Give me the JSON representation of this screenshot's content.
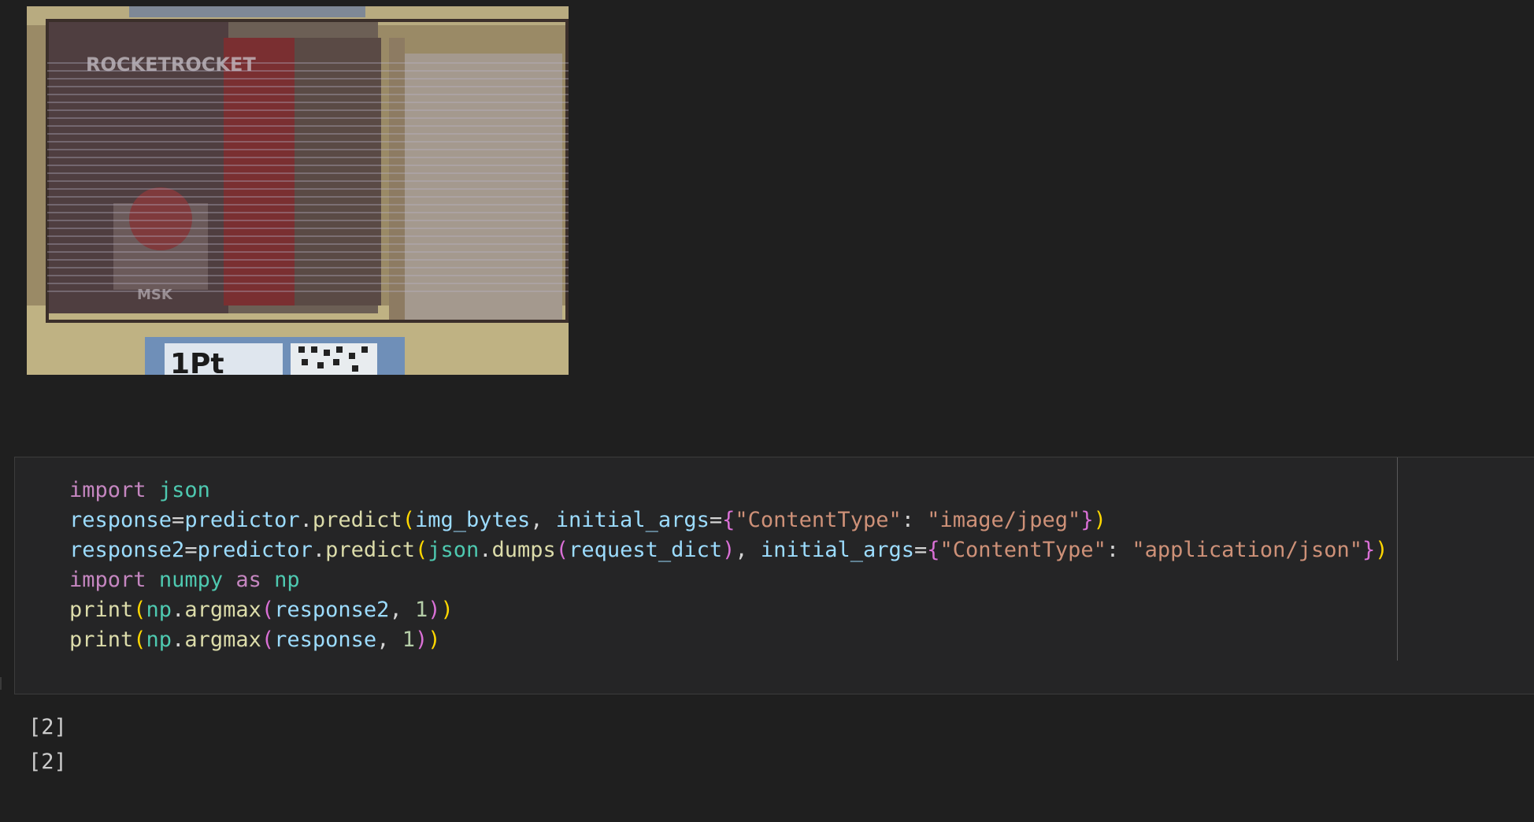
{
  "output_image": {
    "alt": "",
    "carton_brand_text": "ROCKETROCKET",
    "carton_bottom_text": "MSK",
    "price_tag_text": "1Pt"
  },
  "code_cell": {
    "lines": [
      [
        {
          "t": "import",
          "c": "kw"
        },
        {
          "t": " ",
          "c": "op"
        },
        {
          "t": "json",
          "c": "mod"
        }
      ],
      [
        {
          "t": "response",
          "c": "var"
        },
        {
          "t": "=",
          "c": "op"
        },
        {
          "t": "predictor",
          "c": "var"
        },
        {
          "t": ".",
          "c": "op"
        },
        {
          "t": "predict",
          "c": "fn"
        },
        {
          "t": "(",
          "c": "p1"
        },
        {
          "t": "img_bytes",
          "c": "var"
        },
        {
          "t": ", ",
          "c": "op"
        },
        {
          "t": "initial_args",
          "c": "var"
        },
        {
          "t": "=",
          "c": "op"
        },
        {
          "t": "{",
          "c": "p2"
        },
        {
          "t": "\"ContentType\"",
          "c": "str"
        },
        {
          "t": ": ",
          "c": "op"
        },
        {
          "t": "\"image/jpeg\"",
          "c": "str"
        },
        {
          "t": "}",
          "c": "p2"
        },
        {
          "t": ")",
          "c": "p1"
        }
      ],
      [
        {
          "t": "response2",
          "c": "var"
        },
        {
          "t": "=",
          "c": "op"
        },
        {
          "t": "predictor",
          "c": "var"
        },
        {
          "t": ".",
          "c": "op"
        },
        {
          "t": "predict",
          "c": "fn"
        },
        {
          "t": "(",
          "c": "p1"
        },
        {
          "t": "json",
          "c": "mod"
        },
        {
          "t": ".",
          "c": "op"
        },
        {
          "t": "dumps",
          "c": "fn"
        },
        {
          "t": "(",
          "c": "p2"
        },
        {
          "t": "request_dict",
          "c": "var"
        },
        {
          "t": ")",
          "c": "p2"
        },
        {
          "t": ", ",
          "c": "op"
        },
        {
          "t": "initial_args",
          "c": "var"
        },
        {
          "t": "=",
          "c": "op"
        },
        {
          "t": "{",
          "c": "p2"
        },
        {
          "t": "\"ContentType\"",
          "c": "str"
        },
        {
          "t": ": ",
          "c": "op"
        },
        {
          "t": "\"application/json\"",
          "c": "str"
        },
        {
          "t": "}",
          "c": "p2"
        },
        {
          "t": ")",
          "c": "p1"
        }
      ],
      [
        {
          "t": "import",
          "c": "kw"
        },
        {
          "t": " ",
          "c": "op"
        },
        {
          "t": "numpy",
          "c": "mod"
        },
        {
          "t": " ",
          "c": "op"
        },
        {
          "t": "as",
          "c": "kw"
        },
        {
          "t": " ",
          "c": "op"
        },
        {
          "t": "np",
          "c": "mod"
        }
      ],
      [
        {
          "t": "print",
          "c": "fn"
        },
        {
          "t": "(",
          "c": "p1"
        },
        {
          "t": "np",
          "c": "mod"
        },
        {
          "t": ".",
          "c": "op"
        },
        {
          "t": "argmax",
          "c": "fn"
        },
        {
          "t": "(",
          "c": "p2"
        },
        {
          "t": "response2",
          "c": "var"
        },
        {
          "t": ", ",
          "c": "op"
        },
        {
          "t": "1",
          "c": "num"
        },
        {
          "t": ")",
          "c": "p2"
        },
        {
          "t": ")",
          "c": "p1"
        }
      ],
      [
        {
          "t": "print",
          "c": "fn"
        },
        {
          "t": "(",
          "c": "p1"
        },
        {
          "t": "np",
          "c": "mod"
        },
        {
          "t": ".",
          "c": "op"
        },
        {
          "t": "argmax",
          "c": "fn"
        },
        {
          "t": "(",
          "c": "p2"
        },
        {
          "t": "response",
          "c": "var"
        },
        {
          "t": ", ",
          "c": "op"
        },
        {
          "t": "1",
          "c": "num"
        },
        {
          "t": ")",
          "c": "p2"
        },
        {
          "t": ")",
          "c": "p1"
        }
      ]
    ]
  },
  "output": {
    "lines": [
      "[2]",
      "[2]"
    ]
  },
  "colors": {
    "background": "#1f1f1f",
    "cell_background": "#252526",
    "keyword": "#c586c0",
    "module": "#4ec9b0",
    "variable": "#9cdcfe",
    "function": "#dcdcaa",
    "string": "#ce9178",
    "number": "#b5cea8",
    "bracket_level_1": "#ffd700",
    "bracket_level_2": "#da70d6"
  }
}
